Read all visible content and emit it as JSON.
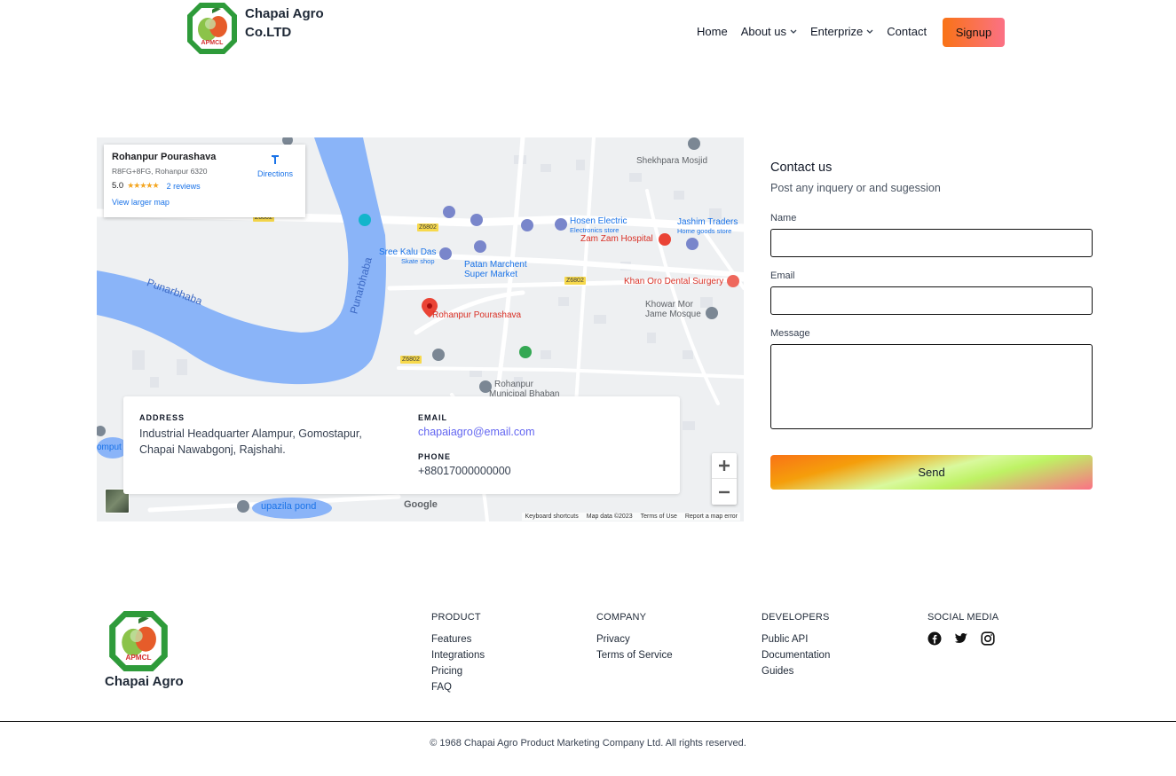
{
  "header": {
    "brand_line1": "Chapai Agro",
    "brand_line2": "Co.LTD",
    "logo_text": "APMCL",
    "nav": [
      {
        "label": "Home",
        "dropdown": false
      },
      {
        "label": "About us",
        "dropdown": true
      },
      {
        "label": "Enterprize",
        "dropdown": true
      },
      {
        "label": "Contact",
        "dropdown": false
      }
    ],
    "signup_label": "Signup"
  },
  "map": {
    "place_title": "Rohanpur Pourashava",
    "place_address": "R8FG+8FG, Rohanpur 6320",
    "rating": "5.0",
    "stars": "★★★★★",
    "reviews": "2 reviews",
    "view_larger": "View larger map",
    "directions": "Directions",
    "labels": {
      "punarbhaba1": "Punarbhaba",
      "punarbhaba2": "Punarbhaba",
      "hosen": "Hosen Electric",
      "hosen_sub": "Electronics store",
      "jashim": "Jashim Traders",
      "jashim_sub": "Home goods store",
      "zamzam": "Zam Zam Hospital",
      "sree": "Sree Kalu Das",
      "sree_sub": "Skate shop",
      "patan": "Patan Marchent",
      "patan2": "Super Market",
      "khan": "Khan Oro Dental Surgery",
      "khowar": "Khowar Mor",
      "khowar2": "Jame Mosque",
      "rohanpur_pin": "Rohanpur Pourashava",
      "shekhpara": "Shekhpara Mosjid",
      "municipal1": "Rohanpur",
      "municipal2": "Municipal Bhaban",
      "upazila": "upazila pond",
      "comput": "omput",
      "road": "Z6802"
    },
    "google": "Google",
    "attrib": [
      "Keyboard shortcuts",
      "Map data ©2023",
      "Terms of Use",
      "Report a map error"
    ]
  },
  "contact_card": {
    "address_label": "ADDRESS",
    "address_line1": "Industrial Headquarter Alampur, Gomostapur,",
    "address_line2": "Chapai Nawabgonj, Rajshahi.",
    "email_label": "EMAIL",
    "email": "chapaiagro@email.com",
    "phone_label": "PHONE",
    "phone": "+88017000000000"
  },
  "form": {
    "title": "Contact us",
    "subtitle": "Post any inquery or and sugession",
    "name_label": "Name",
    "email_label": "Email",
    "message_label": "Message",
    "send_label": "Send"
  },
  "footer": {
    "brand": "Chapai Agro",
    "columns": [
      {
        "heading": "PRODUCT",
        "links": [
          "Features",
          "Integrations",
          "Pricing",
          "FAQ"
        ]
      },
      {
        "heading": "COMPANY",
        "links": [
          "Privacy",
          "Terms of Service"
        ]
      },
      {
        "heading": "DEVELOPERS",
        "links": [
          "Public API",
          "Documentation",
          "Guides"
        ]
      }
    ],
    "social_heading": "SOCIAL MEDIA",
    "social_icons": [
      "facebook-icon",
      "twitter-icon",
      "instagram-icon"
    ],
    "copyright": "© 1968 Chapai Agro Product Marketing Company Ltd. All rights reserved."
  },
  "colors": {
    "signup_gradient": [
      "#f97316",
      "#fb7185"
    ],
    "email_link": "#6366f1",
    "map_river": "#8ab4f8"
  }
}
